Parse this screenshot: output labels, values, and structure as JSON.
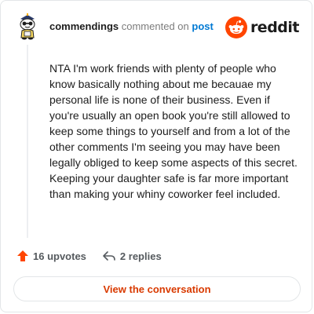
{
  "header": {
    "username": "commendings",
    "action_text": "commented on",
    "post_link": "post"
  },
  "brand": {
    "name": "reddit",
    "icon": "reddit-logo-icon",
    "color": "#ff4500"
  },
  "comment": {
    "text": "NTA I'm work friends with plenty of people who know basically nothing about me becauae my personal life is none of their business. Even if you're usually an open book you're still allowed to keep some things to yourself and from a lot of the other comments I'm seeing you may have been legally obliged to keep some aspects of this secret. Keeping your daughter safe is far more important than making your whiny coworker feel included."
  },
  "actions": {
    "upvotes_label": "16 upvotes",
    "upvote_icon": "upvote-arrow-icon",
    "replies_label": "2 replies",
    "reply_icon": "reply-arrow-icon"
  },
  "footer": {
    "view_button_label": "View the conversation"
  },
  "colors": {
    "upvote": "#ff4500",
    "link": "#0079d3",
    "cta": "#d93a00"
  }
}
